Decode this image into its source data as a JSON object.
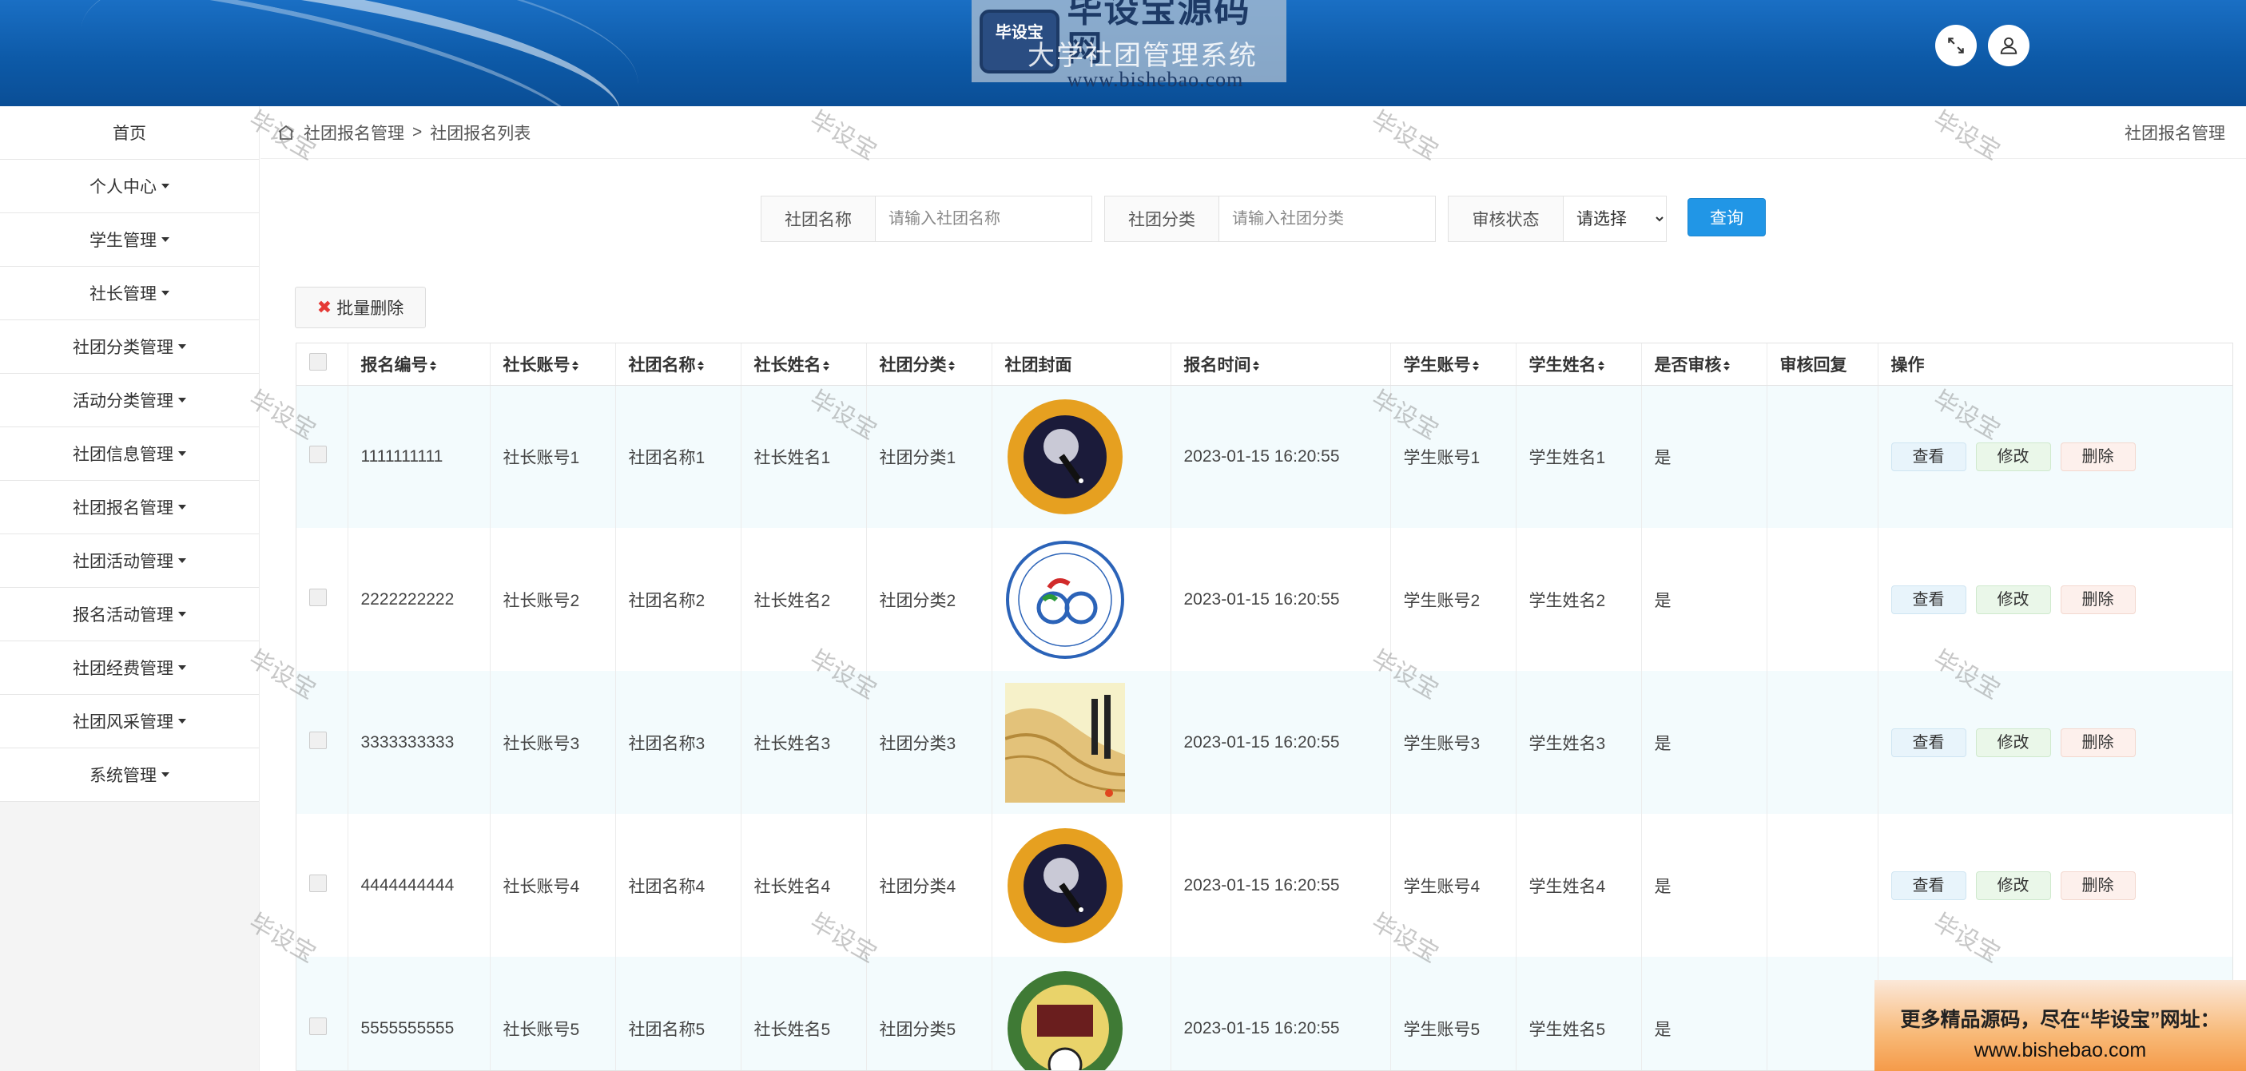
{
  "header": {
    "system_title": "大学社团管理系统",
    "brand_name": "毕设宝源码网",
    "brand_url": "www.bishebao.com",
    "brand_badge": "毕设宝"
  },
  "sidebar": {
    "items": [
      {
        "label": "首页",
        "caret": false
      },
      {
        "label": "个人中心",
        "caret": true
      },
      {
        "label": "学生管理",
        "caret": true
      },
      {
        "label": "社长管理",
        "caret": true
      },
      {
        "label": "社团分类管理",
        "caret": true
      },
      {
        "label": "活动分类管理",
        "caret": true
      },
      {
        "label": "社团信息管理",
        "caret": true
      },
      {
        "label": "社团报名管理",
        "caret": true
      },
      {
        "label": "社团活动管理",
        "caret": true
      },
      {
        "label": "报名活动管理",
        "caret": true
      },
      {
        "label": "社团经费管理",
        "caret": true
      },
      {
        "label": "社团风采管理",
        "caret": true
      },
      {
        "label": "系统管理",
        "caret": true
      }
    ]
  },
  "breadcrumb": {
    "section": "社团报名管理",
    "page": "社团报名列表",
    "right": "社团报名管理",
    "separator": ">"
  },
  "search": {
    "name_label": "社团名称",
    "name_placeholder": "请输入社团名称",
    "category_label": "社团分类",
    "category_placeholder": "请输入社团分类",
    "status_label": "审核状态",
    "status_value": "请选择",
    "query_button": "查询"
  },
  "batch_delete": "批量删除",
  "table": {
    "columns": [
      "报名编号",
      "社长账号",
      "社团名称",
      "社长姓名",
      "社团分类",
      "社团封面",
      "报名时间",
      "学生账号",
      "学生姓名",
      "是否审核",
      "审核回复",
      "操作"
    ],
    "rows": [
      {
        "id": "1111111111",
        "leader_account": "社长账号1",
        "club_name": "社团名称1",
        "leader_name": "社长姓名1",
        "category": "社团分类1",
        "cover": "astronomy",
        "time": "2023-01-15 16:20:55",
        "student_account": "学生账号1",
        "student_name": "学生姓名1",
        "audited": "是",
        "reply": ""
      },
      {
        "id": "2222222222",
        "leader_account": "社长账号2",
        "club_name": "社团名称2",
        "leader_name": "社长姓名2",
        "category": "社团分类2",
        "cover": "cycling",
        "time": "2023-01-15 16:20:55",
        "student_account": "学生账号2",
        "student_name": "学生姓名2",
        "audited": "是",
        "reply": ""
      },
      {
        "id": "3333333333",
        "leader_account": "社长账号3",
        "club_name": "社团名称3",
        "leader_name": "社长姓名3",
        "category": "社团分类3",
        "cover": "culture",
        "time": "2023-01-15 16:20:55",
        "student_account": "学生账号3",
        "student_name": "学生姓名3",
        "audited": "是",
        "reply": ""
      },
      {
        "id": "4444444444",
        "leader_account": "社长账号4",
        "club_name": "社团名称4",
        "leader_name": "社长姓名4",
        "category": "社团分类4",
        "cover": "astronomy",
        "time": "2023-01-15 16:20:55",
        "student_account": "学生账号4",
        "student_name": "学生姓名4",
        "audited": "是",
        "reply": ""
      },
      {
        "id": "5555555555",
        "leader_account": "社长账号5",
        "club_name": "社团名称5",
        "leader_name": "社长姓名5",
        "category": "社团分类5",
        "cover": "football",
        "time": "2023-01-15 16:20:55",
        "student_account": "学生账号5",
        "student_name": "学生姓名5",
        "audited": "是",
        "reply": ""
      }
    ],
    "actions": {
      "view": "查看",
      "edit": "修改",
      "delete": "删除"
    }
  },
  "watermark": "毕设宝",
  "promo": {
    "line1": "更多精品源码，尽在“毕设宝”网址：",
    "line2": "www.bishebao.com"
  },
  "icons": {
    "fullscreen": "fullscreen-icon",
    "user": "user-icon",
    "home": "home-icon",
    "delete": "close-icon"
  },
  "colors": {
    "header_blue": "#0d5aa8",
    "query_button": "#2196e6",
    "row_stripe": "#f3fbfd"
  }
}
